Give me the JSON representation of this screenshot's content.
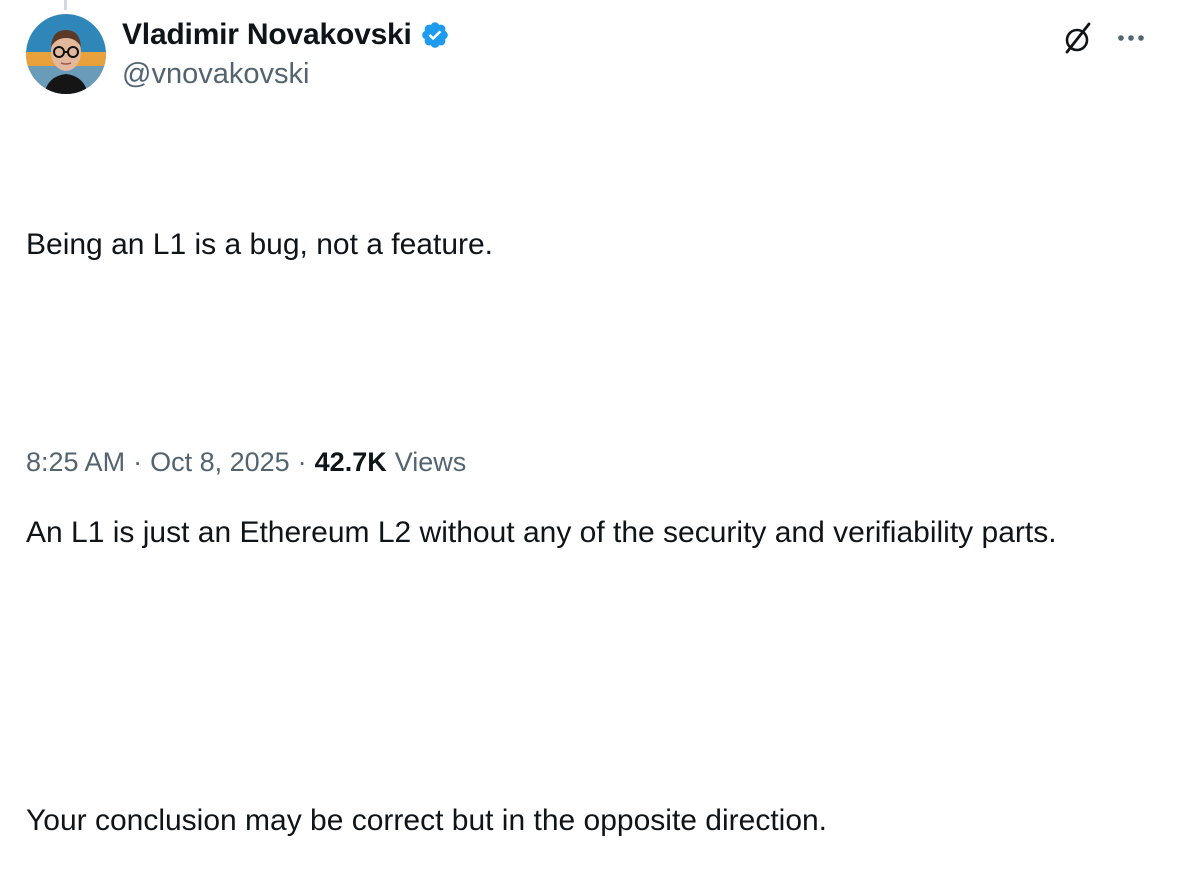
{
  "author": {
    "display_name": "Vladimir Novakovski",
    "handle": "@vnovakovski",
    "verified": true,
    "verified_icon": "verified-badge-icon",
    "verified_color": "#1d9bf0"
  },
  "header_actions": {
    "grok_icon": "grok-icon",
    "more_icon": "more-horizontal-icon"
  },
  "tweet": {
    "paragraphs": [
      "Being an L1 is a bug, not a feature.",
      "An L1 is just an Ethereum L2 without any of the security and verifiability parts.",
      "Your conclusion may be correct but in the opposite direction."
    ]
  },
  "meta": {
    "time": "8:25 AM",
    "separator": "·",
    "date": "Oct 8, 2025",
    "views_count": "42.7K",
    "views_label": "Views"
  },
  "colors": {
    "text_primary": "#0f1419",
    "text_secondary": "#536471",
    "accent": "#1d9bf0",
    "thread_line": "#cfd9de"
  }
}
